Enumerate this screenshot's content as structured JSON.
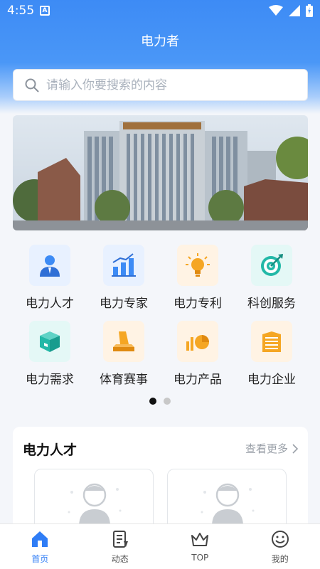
{
  "status": {
    "time": "4:55"
  },
  "app": {
    "title": "电力者"
  },
  "search": {
    "placeholder": "请输入你要搜索的内容"
  },
  "banner": {
    "alt": ""
  },
  "grid": {
    "items": [
      {
        "label": "电力人才",
        "icon": "person-icon",
        "bg": "#e8f1ff"
      },
      {
        "label": "电力专家",
        "icon": "bar-chart-icon",
        "bg": "#e8f1ff"
      },
      {
        "label": "电力专利",
        "icon": "lightbulb-icon",
        "bg": "#fff3e4"
      },
      {
        "label": "科创服务",
        "icon": "target-icon",
        "bg": "#e4f8f6"
      },
      {
        "label": "电力需求",
        "icon": "box-icon",
        "bg": "#e4f8f6"
      },
      {
        "label": "体育赛事",
        "icon": "sports-icon",
        "bg": "#fff3e4"
      },
      {
        "label": "电力产品",
        "icon": "pie-chart-icon",
        "bg": "#fff3e4"
      },
      {
        "label": "电力企业",
        "icon": "building-icon",
        "bg": "#fff3e4"
      }
    ]
  },
  "pager": {
    "count": 2,
    "active": 0
  },
  "section": {
    "title": "电力人才",
    "more": "查看更多"
  },
  "tabs": [
    {
      "label": "首页",
      "icon": "home-icon",
      "active": true
    },
    {
      "label": "动态",
      "icon": "document-icon",
      "active": false
    },
    {
      "label": "TOP",
      "icon": "crown-icon",
      "active": false
    },
    {
      "label": "我的",
      "icon": "smile-icon",
      "active": false
    }
  ],
  "colors": {
    "accent": "#2f7df6",
    "header": "#4a97f7"
  }
}
